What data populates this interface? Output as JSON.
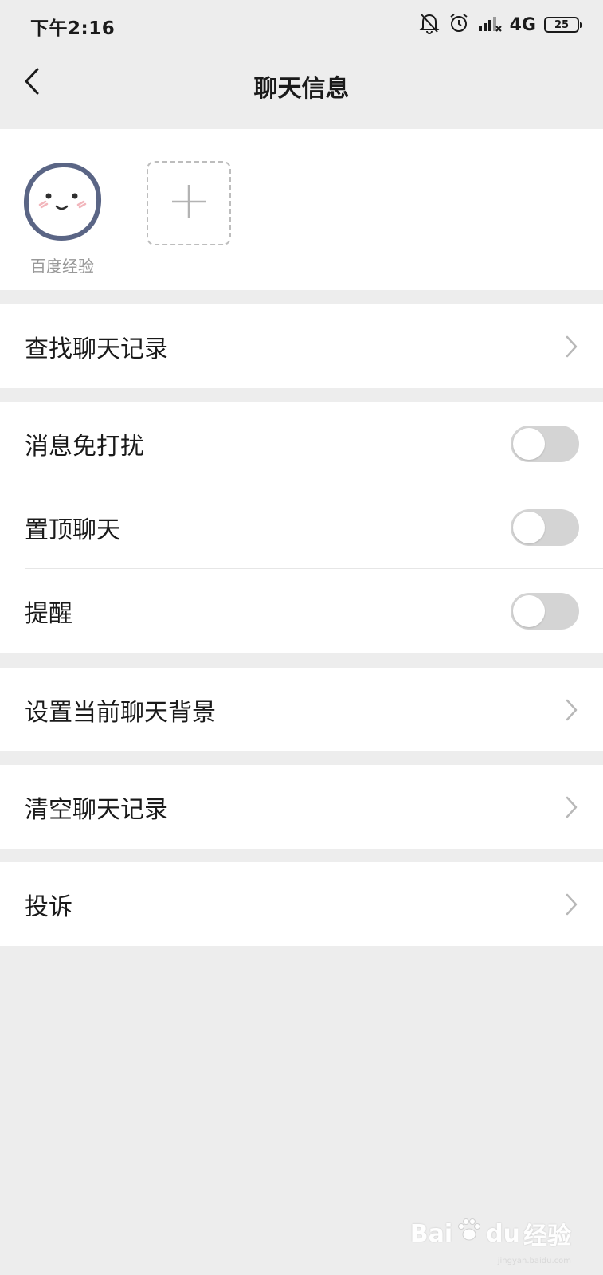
{
  "status_bar": {
    "time": "下午2:16",
    "network": "4G",
    "battery": "25",
    "icons": [
      "bell-muted-icon",
      "alarm-icon",
      "signal-icon"
    ]
  },
  "header": {
    "title": "聊天信息",
    "back_icon": "chevron-left-icon"
  },
  "members": {
    "items": [
      {
        "name": "百度经验",
        "avatar": "smiley-face-avatar"
      }
    ],
    "add_icon": "plus-icon"
  },
  "menu": {
    "search_history": "查找聊天记录",
    "mute": {
      "label": "消息免打扰",
      "on": false
    },
    "pin": {
      "label": "置顶聊天",
      "on": false
    },
    "remind": {
      "label": "提醒",
      "on": false
    },
    "background": "设置当前聊天背景",
    "clear_history": "清空聊天记录",
    "report": "投诉"
  },
  "watermark": {
    "brand": "Bai",
    "brand2": "du",
    "suffix": "经验",
    "url": "jingyan.baidu.com"
  },
  "colors": {
    "background": "#ededed",
    "card": "#ffffff",
    "toggle_off": "#d4d4d4",
    "secondary_text": "#999999"
  }
}
